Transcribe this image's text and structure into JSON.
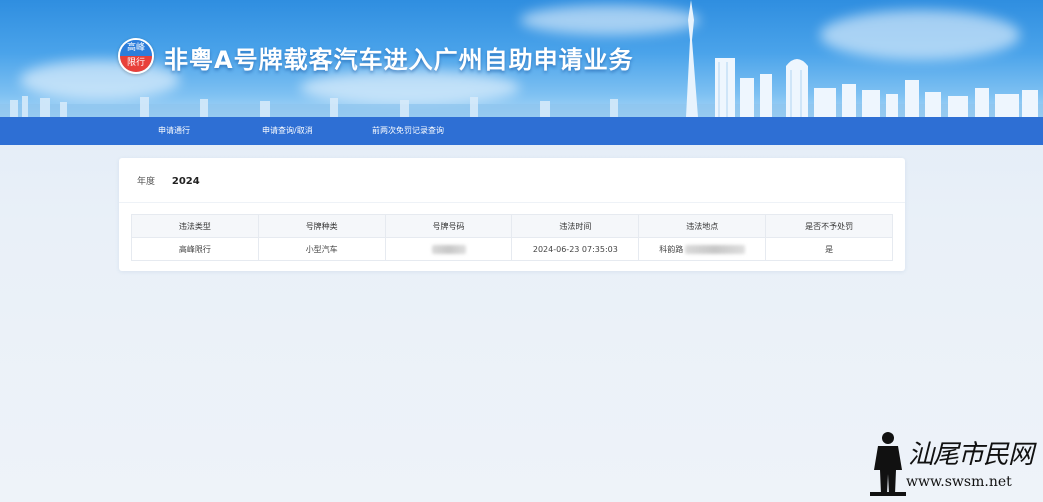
{
  "header": {
    "badge_top": "高峰",
    "badge_bottom": "限行",
    "title": "非粤A号牌载客汽车进入广州自助申请业务"
  },
  "nav": {
    "items": [
      {
        "label": "申请通行"
      },
      {
        "label": "申请查询/取消"
      },
      {
        "label": "前两次免罚记录查询"
      }
    ]
  },
  "main": {
    "year_label": "年度",
    "year_value": "2024",
    "table": {
      "headers": [
        "违法类型",
        "号牌种类",
        "号牌号码",
        "违法时间",
        "违法地点",
        "是否不予处罚"
      ],
      "rows": [
        {
          "type": "高峰限行",
          "plate_kind": "小型汽车",
          "plate_number": "",
          "time": "2024-06-23 07:35:03",
          "location": "科韵路",
          "no_penalty": "是"
        }
      ]
    }
  },
  "watermark": {
    "text": "汕尾市民网",
    "url": "www.swsm.net"
  },
  "colors": {
    "nav_bg": "#2e6fd4",
    "badge_top": "#2c7ddb",
    "badge_bottom": "#e8403a",
    "page_bg": "#e9f0f8"
  }
}
